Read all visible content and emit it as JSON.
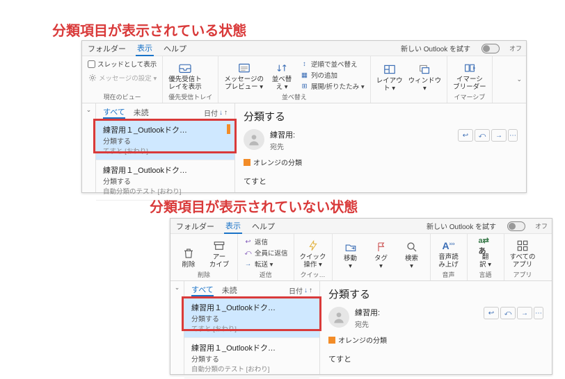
{
  "captions": {
    "shown": "分類項目が表示されている状態",
    "hidden": "分類項目が表示されていない状態"
  },
  "titlebar": {
    "tabs": {
      "folder": "フォルダー",
      "view": "表示",
      "help": "ヘルプ"
    },
    "try_outlook": "新しい Outlook を試す",
    "off": "オフ"
  },
  "ribbon1": {
    "group1_label": "現在のビュー",
    "thread_view": "スレッドとして表示",
    "msg_settings": "メッセージの設定 ▾",
    "priority_inbox": "優先受信ト\nレイを表示",
    "group2_label": "優先受信トレイ",
    "msg_preview": "メッセージの\nプレビュー ▾",
    "sort": "並べ替\nえ ▾",
    "reverse_sort": "逆順で並べ替え",
    "add_columns": "列の追加",
    "expand_collapse": "展開/折りたたみ ▾",
    "group3_label": "並べ替え",
    "layout": "レイアウ\nト ▾",
    "window": "ウィンドウ\n▾",
    "immersive": "イマーシ\nブリーダー",
    "group4_label": "イマーシブ"
  },
  "ribbon2": {
    "delete": "削除",
    "archive": "アー\nカイブ",
    "g_delete": "削除",
    "reply": "返信",
    "reply_all": "全員に返信",
    "forward": "転送 ▾",
    "g_reply": "返信",
    "quick": "クイック\n操作 ▾",
    "g_quick": "クイッ…",
    "move": "移動\n▾",
    "tag": "タグ\n▾",
    "search": "検索\n▾",
    "read_aloud": "音声読\nみ上げ",
    "g_audio": "音声",
    "translate": "翻\n訳 ▾",
    "g_lang": "言語",
    "all_apps": "すべての\nアプリ",
    "g_apps": "アプリ"
  },
  "msglist": {
    "all": "すべて",
    "unread": "未読",
    "sort_label": "日付",
    "items": [
      {
        "title": "練習用１_Outlookドク…",
        "sub": "分類する",
        "meta": "てすと [おわり]"
      },
      {
        "title": "練習用１_Outlookドク…",
        "sub": "分類する",
        "meta": "自動分類のテスト [おわり]"
      }
    ]
  },
  "reading": {
    "subject": "分類する",
    "from": "練習用:",
    "to": "宛先",
    "category": "オレンジの分類",
    "body": "てすと"
  }
}
